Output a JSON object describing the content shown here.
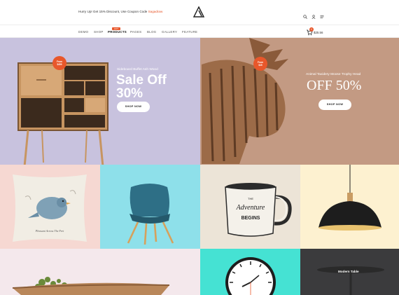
{
  "header": {
    "promo_text": "Hurry Up! Get 15% Discount, Use Coupon Code",
    "promo_code": "Sagadraw",
    "logo_icon": "triangle-logo-icon",
    "icons": [
      "search-icon",
      "user-icon",
      "menu-icon"
    ]
  },
  "nav": {
    "items": [
      {
        "label": "DEMO"
      },
      {
        "label": "SHOP"
      },
      {
        "label": "PRODUCTS"
      },
      {
        "label": "PAGES"
      },
      {
        "label": "BLOG"
      },
      {
        "label": "GALLERY"
      },
      {
        "label": "FEATURE"
      }
    ],
    "badge": "HOT",
    "cart_count": "0",
    "cart_total": "$25.56"
  },
  "banners": [
    {
      "price_badge_label": "From",
      "price_badge_value": "$459",
      "subtitle": "Sideboard Buffet Ash Wood",
      "title_line1": "Sale Off",
      "title_line2": "30%",
      "button": "SHOP NOW"
    },
    {
      "price_badge_label": "From",
      "price_badge_value": "$45",
      "subtitle": "Animal Taxidery Moose Trophy Head",
      "title": "OFF 50%",
      "button": "SHOP NOW"
    }
  ],
  "tiles": {
    "mug_text_top": "THE",
    "mug_text_main": "Adventure",
    "mug_text_bottom": "BEGINS",
    "pillow_text": "Pleasant Across The Fret",
    "modern_table_label": "Modern Table"
  },
  "colors": {
    "accent": "#e8572b",
    "banner1_bg": "#c8c2de",
    "banner2_bg": "#c39a83",
    "pillow_bg": "#f6d8d2",
    "chair_bg": "#8ee0ea",
    "mug_bg": "#ece4d7",
    "lamp_bg": "#fdf1d0",
    "clock_bg": "#45e2d3",
    "table_bg": "#3b3b3d"
  }
}
